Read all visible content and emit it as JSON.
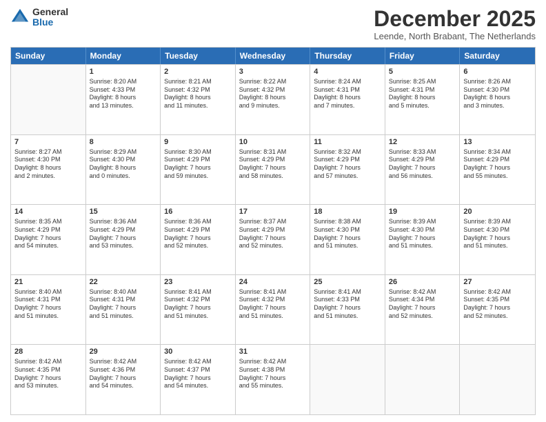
{
  "logo": {
    "general": "General",
    "blue": "Blue"
  },
  "header": {
    "month": "December 2025",
    "location": "Leende, North Brabant, The Netherlands"
  },
  "days_of_week": [
    "Sunday",
    "Monday",
    "Tuesday",
    "Wednesday",
    "Thursday",
    "Friday",
    "Saturday"
  ],
  "weeks": [
    [
      {
        "day": "",
        "lines": []
      },
      {
        "day": "1",
        "lines": [
          "Sunrise: 8:20 AM",
          "Sunset: 4:33 PM",
          "Daylight: 8 hours",
          "and 13 minutes."
        ]
      },
      {
        "day": "2",
        "lines": [
          "Sunrise: 8:21 AM",
          "Sunset: 4:32 PM",
          "Daylight: 8 hours",
          "and 11 minutes."
        ]
      },
      {
        "day": "3",
        "lines": [
          "Sunrise: 8:22 AM",
          "Sunset: 4:32 PM",
          "Daylight: 8 hours",
          "and 9 minutes."
        ]
      },
      {
        "day": "4",
        "lines": [
          "Sunrise: 8:24 AM",
          "Sunset: 4:31 PM",
          "Daylight: 8 hours",
          "and 7 minutes."
        ]
      },
      {
        "day": "5",
        "lines": [
          "Sunrise: 8:25 AM",
          "Sunset: 4:31 PM",
          "Daylight: 8 hours",
          "and 5 minutes."
        ]
      },
      {
        "day": "6",
        "lines": [
          "Sunrise: 8:26 AM",
          "Sunset: 4:30 PM",
          "Daylight: 8 hours",
          "and 3 minutes."
        ]
      }
    ],
    [
      {
        "day": "7",
        "lines": [
          "Sunrise: 8:27 AM",
          "Sunset: 4:30 PM",
          "Daylight: 8 hours",
          "and 2 minutes."
        ]
      },
      {
        "day": "8",
        "lines": [
          "Sunrise: 8:29 AM",
          "Sunset: 4:30 PM",
          "Daylight: 8 hours",
          "and 0 minutes."
        ]
      },
      {
        "day": "9",
        "lines": [
          "Sunrise: 8:30 AM",
          "Sunset: 4:29 PM",
          "Daylight: 7 hours",
          "and 59 minutes."
        ]
      },
      {
        "day": "10",
        "lines": [
          "Sunrise: 8:31 AM",
          "Sunset: 4:29 PM",
          "Daylight: 7 hours",
          "and 58 minutes."
        ]
      },
      {
        "day": "11",
        "lines": [
          "Sunrise: 8:32 AM",
          "Sunset: 4:29 PM",
          "Daylight: 7 hours",
          "and 57 minutes."
        ]
      },
      {
        "day": "12",
        "lines": [
          "Sunrise: 8:33 AM",
          "Sunset: 4:29 PM",
          "Daylight: 7 hours",
          "and 56 minutes."
        ]
      },
      {
        "day": "13",
        "lines": [
          "Sunrise: 8:34 AM",
          "Sunset: 4:29 PM",
          "Daylight: 7 hours",
          "and 55 minutes."
        ]
      }
    ],
    [
      {
        "day": "14",
        "lines": [
          "Sunrise: 8:35 AM",
          "Sunset: 4:29 PM",
          "Daylight: 7 hours",
          "and 54 minutes."
        ]
      },
      {
        "day": "15",
        "lines": [
          "Sunrise: 8:36 AM",
          "Sunset: 4:29 PM",
          "Daylight: 7 hours",
          "and 53 minutes."
        ]
      },
      {
        "day": "16",
        "lines": [
          "Sunrise: 8:36 AM",
          "Sunset: 4:29 PM",
          "Daylight: 7 hours",
          "and 52 minutes."
        ]
      },
      {
        "day": "17",
        "lines": [
          "Sunrise: 8:37 AM",
          "Sunset: 4:29 PM",
          "Daylight: 7 hours",
          "and 52 minutes."
        ]
      },
      {
        "day": "18",
        "lines": [
          "Sunrise: 8:38 AM",
          "Sunset: 4:30 PM",
          "Daylight: 7 hours",
          "and 51 minutes."
        ]
      },
      {
        "day": "19",
        "lines": [
          "Sunrise: 8:39 AM",
          "Sunset: 4:30 PM",
          "Daylight: 7 hours",
          "and 51 minutes."
        ]
      },
      {
        "day": "20",
        "lines": [
          "Sunrise: 8:39 AM",
          "Sunset: 4:30 PM",
          "Daylight: 7 hours",
          "and 51 minutes."
        ]
      }
    ],
    [
      {
        "day": "21",
        "lines": [
          "Sunrise: 8:40 AM",
          "Sunset: 4:31 PM",
          "Daylight: 7 hours",
          "and 51 minutes."
        ]
      },
      {
        "day": "22",
        "lines": [
          "Sunrise: 8:40 AM",
          "Sunset: 4:31 PM",
          "Daylight: 7 hours",
          "and 51 minutes."
        ]
      },
      {
        "day": "23",
        "lines": [
          "Sunrise: 8:41 AM",
          "Sunset: 4:32 PM",
          "Daylight: 7 hours",
          "and 51 minutes."
        ]
      },
      {
        "day": "24",
        "lines": [
          "Sunrise: 8:41 AM",
          "Sunset: 4:32 PM",
          "Daylight: 7 hours",
          "and 51 minutes."
        ]
      },
      {
        "day": "25",
        "lines": [
          "Sunrise: 8:41 AM",
          "Sunset: 4:33 PM",
          "Daylight: 7 hours",
          "and 51 minutes."
        ]
      },
      {
        "day": "26",
        "lines": [
          "Sunrise: 8:42 AM",
          "Sunset: 4:34 PM",
          "Daylight: 7 hours",
          "and 52 minutes."
        ]
      },
      {
        "day": "27",
        "lines": [
          "Sunrise: 8:42 AM",
          "Sunset: 4:35 PM",
          "Daylight: 7 hours",
          "and 52 minutes."
        ]
      }
    ],
    [
      {
        "day": "28",
        "lines": [
          "Sunrise: 8:42 AM",
          "Sunset: 4:35 PM",
          "Daylight: 7 hours",
          "and 53 minutes."
        ]
      },
      {
        "day": "29",
        "lines": [
          "Sunrise: 8:42 AM",
          "Sunset: 4:36 PM",
          "Daylight: 7 hours",
          "and 54 minutes."
        ]
      },
      {
        "day": "30",
        "lines": [
          "Sunrise: 8:42 AM",
          "Sunset: 4:37 PM",
          "Daylight: 7 hours",
          "and 54 minutes."
        ]
      },
      {
        "day": "31",
        "lines": [
          "Sunrise: 8:42 AM",
          "Sunset: 4:38 PM",
          "Daylight: 7 hours",
          "and 55 minutes."
        ]
      },
      {
        "day": "",
        "lines": []
      },
      {
        "day": "",
        "lines": []
      },
      {
        "day": "",
        "lines": []
      }
    ]
  ]
}
